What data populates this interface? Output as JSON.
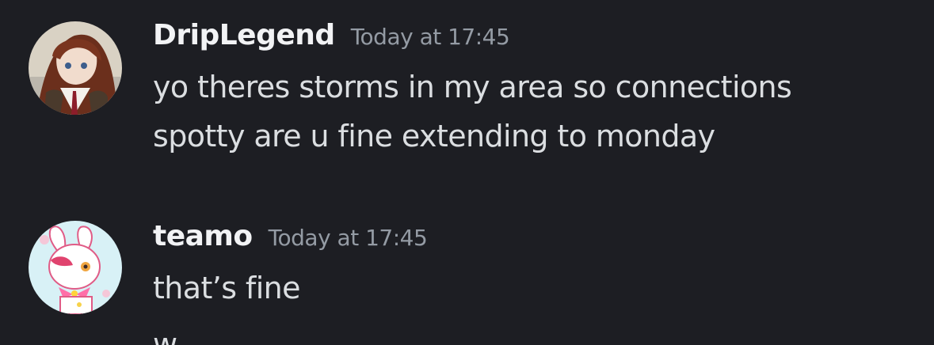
{
  "messages": [
    {
      "username": "DripLegend",
      "timestamp": "Today at 17:45",
      "avatar_icon": "anime-girl-avatar-icon",
      "lines": [
        "yo theres storms in my area so connections",
        "spotty are u fine extending to monday"
      ]
    },
    {
      "username": "teamo",
      "timestamp": "Today at 17:45",
      "avatar_icon": "pink-white-bunny-character-avatar-icon",
      "lines": [
        "that’s fine",
        "w"
      ]
    }
  ],
  "colors": {
    "background": "#1d1e23",
    "username": "#f2f3f5",
    "timestamp": "#949ba4",
    "message_text": "#dbdee1"
  }
}
